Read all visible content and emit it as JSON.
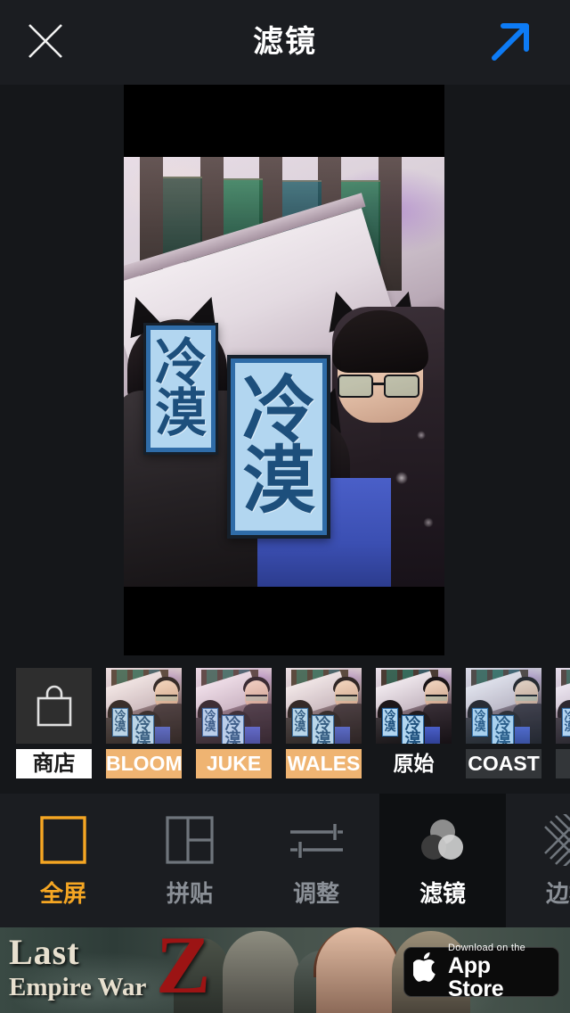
{
  "header": {
    "title": "滤镜",
    "close_icon": "close-x-icon",
    "share_icon": "share-arrow-icon",
    "share_color": "#0d7bf5"
  },
  "preview": {
    "sticker_text": "冷漠",
    "sticker_chars": [
      "冷",
      "漠"
    ],
    "sticker_border_color": "#2f6ca8",
    "sticker_fill_color": "#b2d6f0",
    "sticker_text_color": "#1d4f7c",
    "letterbox_color": "#000000"
  },
  "filters": {
    "items": [
      {
        "label": "商店",
        "style": "white",
        "type": "shop",
        "icon": "shopping-bag-icon",
        "grade": "g-none"
      },
      {
        "label": "BLOOM",
        "style": "orange",
        "type": "filter",
        "grade": "g-bloom"
      },
      {
        "label": "JUKE",
        "style": "orange",
        "type": "filter",
        "grade": "g-juke"
      },
      {
        "label": "WALES",
        "style": "orange",
        "type": "filter",
        "grade": "g-wales"
      },
      {
        "label": "原始",
        "style": "none",
        "type": "filter",
        "grade": "g-none"
      },
      {
        "label": "COAST",
        "style": "dark",
        "type": "filter",
        "grade": "g-coast"
      },
      {
        "label": "",
        "style": "dark",
        "type": "filter",
        "grade": "g-next"
      }
    ]
  },
  "bottom_nav": {
    "items": [
      {
        "label": "全屏",
        "icon": "fullscreen-square-icon",
        "state": "selected-orange"
      },
      {
        "label": "拼贴",
        "icon": "collage-grid-icon",
        "state": "inactive"
      },
      {
        "label": "调整",
        "icon": "adjust-sliders-icon",
        "state": "inactive"
      },
      {
        "label": "滤镜",
        "icon": "filter-circles-icon",
        "state": "active-white"
      },
      {
        "label": "边框",
        "icon": "border-hatch-icon",
        "state": "inactive"
      }
    ],
    "active_color": "#f5a623",
    "inactive_color": "#8a8f96"
  },
  "ad": {
    "title_line1": "Last",
    "title_line2": "Empire War",
    "title_z": "Z",
    "store_small": "Download on the",
    "store_big": "App Store",
    "apple_glyph": "",
    "badge_name": "app-store-badge"
  }
}
